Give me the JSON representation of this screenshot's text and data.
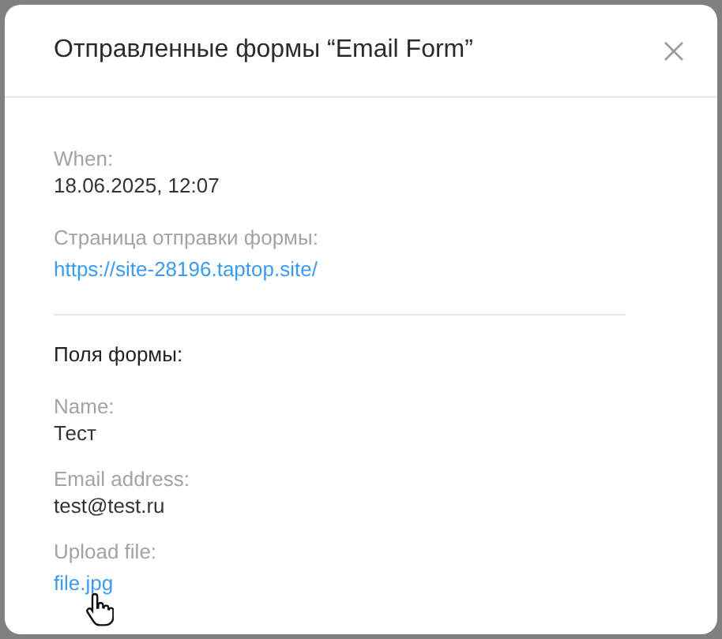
{
  "dialog": {
    "title": "Отправленные формы “Email Form”"
  },
  "meta": [
    {
      "label": "When:",
      "value": "18.06.2025, 12:07",
      "kind": "text"
    },
    {
      "label": "Страница отправки формы:",
      "value": "https://site-28196.taptop.site/",
      "kind": "link"
    }
  ],
  "section_title": "Поля формы:",
  "fields": [
    {
      "label": "Name:",
      "value": "Тест",
      "kind": "text"
    },
    {
      "label": "Email address:",
      "value": "test@test.ru",
      "kind": "text"
    },
    {
      "label": "Upload file:",
      "value": "file.jpg",
      "kind": "link"
    }
  ]
}
